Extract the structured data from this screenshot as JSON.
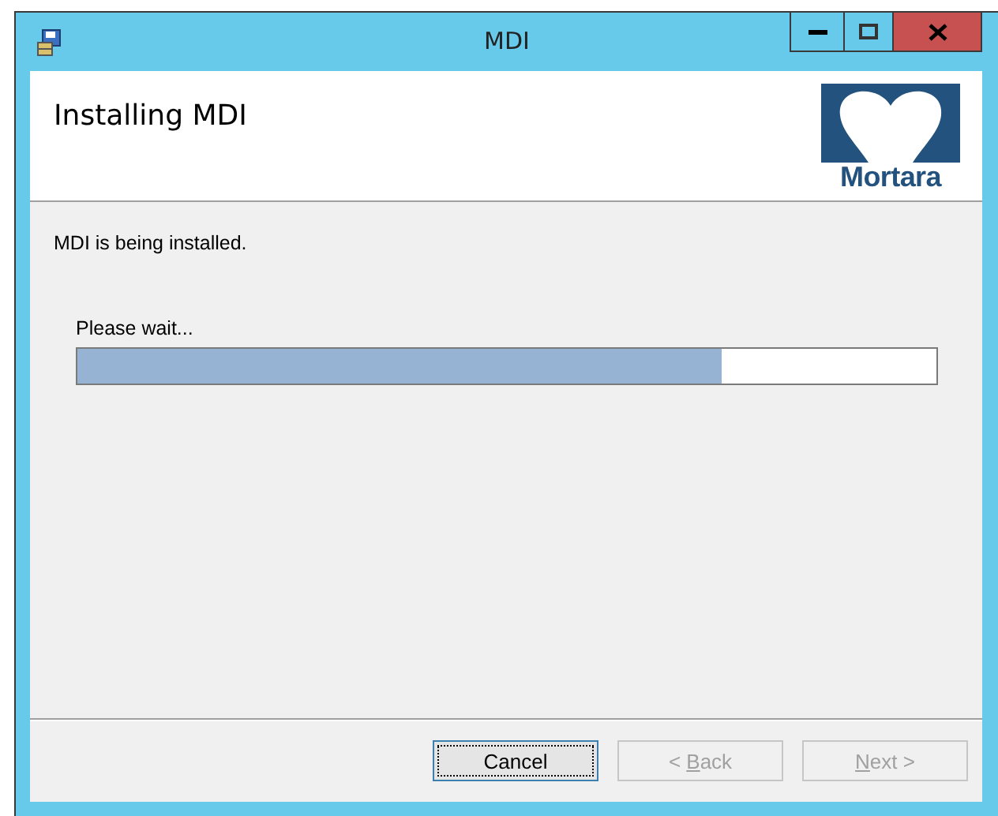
{
  "window": {
    "title": "MDI"
  },
  "header": {
    "title": "Installing MDI",
    "logo_text": "Mortara"
  },
  "status": "MDI is being installed.",
  "progress": {
    "label": "Please wait...",
    "level": 0.75
  },
  "buttons": [
    {
      "label_before": "Cancel",
      "default": true,
      "disabled": false
    },
    {
      "label_before": "< ",
      "access_key": "B",
      "label_after": "ack",
      "default": false,
      "disabled": true
    },
    {
      "access_key": "N",
      "label_after": "ext >",
      "default": false,
      "disabled": true
    }
  ]
}
